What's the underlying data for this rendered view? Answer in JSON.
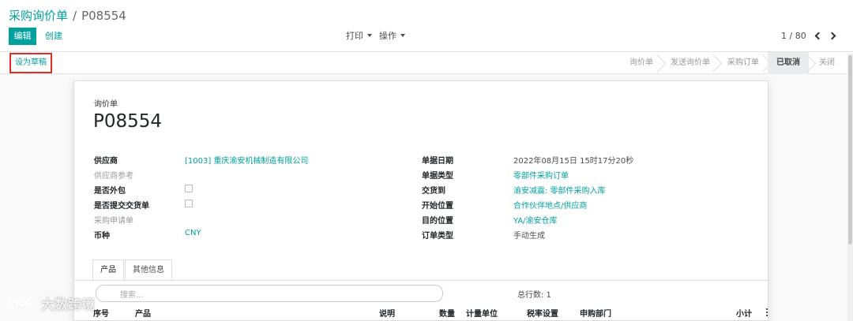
{
  "breadcrumb": {
    "parent": "采购询价单",
    "separator": "/",
    "current": "P08554"
  },
  "toolbar": {
    "edit_label": "编辑",
    "create_label": "创建",
    "print_label": "打印",
    "action_label": "操作"
  },
  "pager": {
    "value": "1 / 80"
  },
  "statusbar": {
    "draft_button": "设为草稿",
    "stages": [
      "询价单",
      "发送询价单",
      "采购订单",
      "已取消",
      "关闭"
    ],
    "active_stage": "已取消"
  },
  "form": {
    "doc_type_label": "询价单",
    "doc_number": "P08554",
    "left_fields": [
      {
        "label": "供应商",
        "value": "[1003] 重庆渝安机械制造有限公司"
      },
      {
        "label": "供应商参考",
        "value": ""
      },
      {
        "label": "是否外包",
        "value": ""
      },
      {
        "label": "是否提交交货单",
        "value": ""
      },
      {
        "label": "采购申请单",
        "value": ""
      },
      {
        "label": "币种",
        "value": "CNY"
      }
    ],
    "right_fields": [
      {
        "label": "单据日期",
        "value": "2022年08月15日 15时17分20秒"
      },
      {
        "label": "单据类型",
        "value": "零部件采购订单"
      },
      {
        "label": "交货到",
        "value": "渝安减震: 零部件采购入库"
      },
      {
        "label": "开始位置",
        "value": "合作伙伴地点/供应商"
      },
      {
        "label": "目的位置",
        "value": "YA/渝安仓库"
      },
      {
        "label": "订单类型",
        "value": "手动生成"
      }
    ]
  },
  "tabs": {
    "items": [
      "产品",
      "其他信息"
    ]
  },
  "lines": {
    "search_placeholder": "搜索...",
    "total_rows": "总行数: 1",
    "columns": [
      "序号",
      "产品",
      "说明",
      "数量",
      "计量单位",
      "税率设置",
      "申购部门",
      "小计"
    ]
  },
  "watermark": {
    "text": "大数跨境"
  },
  "colors": {
    "accent": "#00a09d",
    "highlight_border": "#e02b27"
  }
}
